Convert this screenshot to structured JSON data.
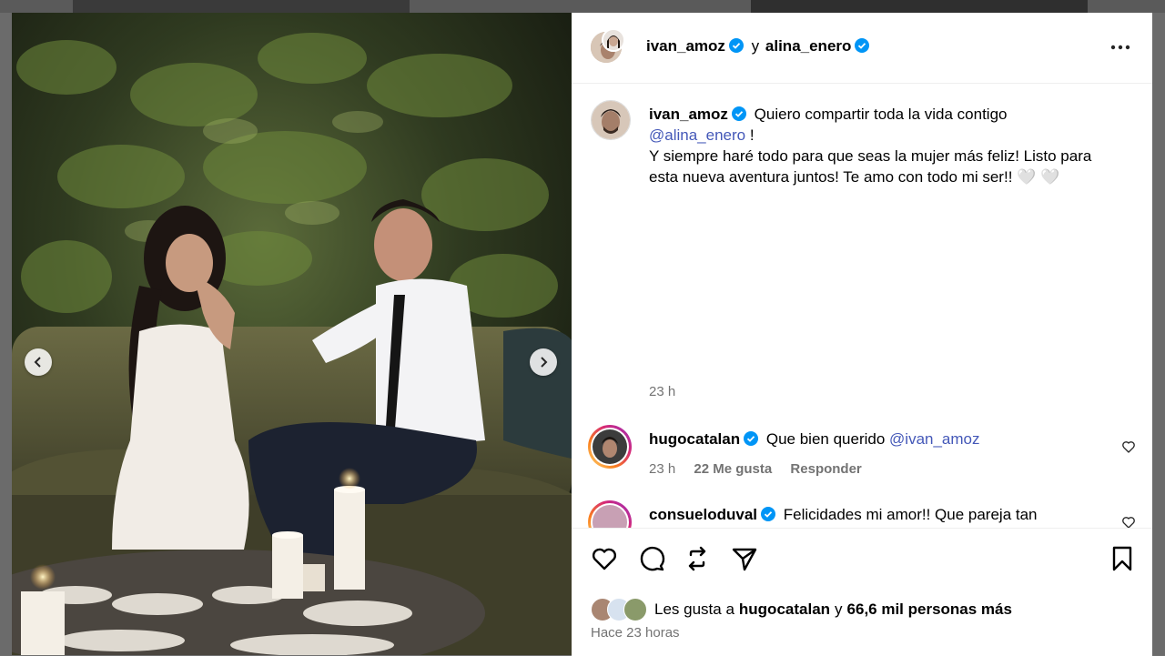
{
  "post": {
    "header": {
      "user1": "ivan_amoz",
      "conjunction": "y",
      "user2": "alina_enero"
    },
    "caption": {
      "author": "ivan_amoz",
      "line1": "Quiero compartir toda la vida contigo",
      "mention": "@alina_enero",
      "mention_suffix": " !",
      "body": "Y siempre haré todo para que seas la mujer más feliz! Listo para esta nueva aventura juntos! Te amo con todo mi ser!! 🤍 🤍",
      "time": "23 h"
    },
    "comments": [
      {
        "user": "hugocatalan",
        "text": "Que bien querido",
        "mention": "@ivan_amoz",
        "time": "23 h",
        "likes": "22 Me gusta",
        "reply": "Responder"
      },
      {
        "user": "consueloduval",
        "text": "Felicidades mi amor!! Que pareja tan"
      }
    ],
    "likes": {
      "prefix": "Les gusta a",
      "user": "hugocatalan",
      "connector": "y",
      "others": "66,6 mil personas más"
    },
    "posted": "Hace 23 horas"
  },
  "icons": {
    "more": "more-options-icon",
    "verified": "verified-badge-icon",
    "prev": "chevron-left-icon",
    "next": "chevron-right-icon",
    "like": "heart-icon",
    "comment": "comment-icon",
    "share": "share-icon",
    "save": "bookmark-icon"
  },
  "colors": {
    "verified": "#0095f6",
    "mention": "#4458b8",
    "muted": "#737373"
  }
}
